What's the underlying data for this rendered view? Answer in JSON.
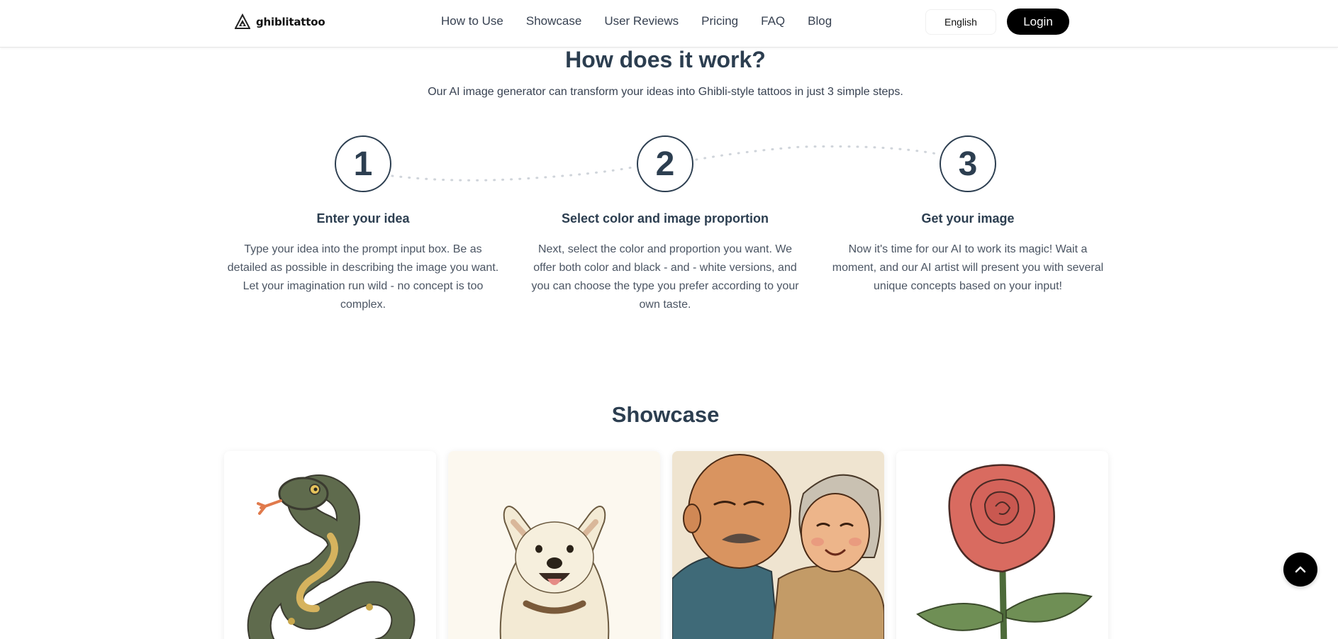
{
  "header": {
    "logo_text": "ghiblitattoo",
    "nav": [
      "How to Use",
      "Showcase",
      "User Reviews",
      "Pricing",
      "FAQ",
      "Blog"
    ],
    "language": "English",
    "login": "Login"
  },
  "how_it_works": {
    "title": "How does it work?",
    "subtitle": "Our AI image generator can transform your ideas into Ghibli-style tattoos in just 3 simple steps.",
    "steps": [
      {
        "number": "1",
        "title": "Enter your idea",
        "lines": [
          "Type your idea into the prompt input box. Be as",
          "detailed as possible in describing the image you want.",
          "Let your imagination run wild - no concept is too",
          "complex."
        ]
      },
      {
        "number": "2",
        "title": "Select color and image proportion",
        "lines": [
          "Next, select the color and proportion you want. We",
          "offer both color and black - and - white versions, and",
          "you can choose the type you prefer according to your",
          "own taste."
        ]
      },
      {
        "number": "3",
        "title": "Get your image",
        "lines": [
          "Now it's time for our AI to work its magic! Wait a",
          "moment, and our AI artist will present you with several",
          "unique concepts based on your input!"
        ]
      }
    ]
  },
  "showcase": {
    "title": "Showcase",
    "items": [
      "snake-tattoo-image",
      "samoyed-dog-tattoo-image",
      "elderly-couple-tattoo-image",
      "red-rose-tattoo-image"
    ]
  },
  "icons": {
    "logo": "triangle-logo-icon",
    "scroll_top": "chevron-up-icon"
  },
  "colors": {
    "heading": "#2c3e50",
    "button_dark": "#000000",
    "connector_dots": "#cfd4da"
  }
}
